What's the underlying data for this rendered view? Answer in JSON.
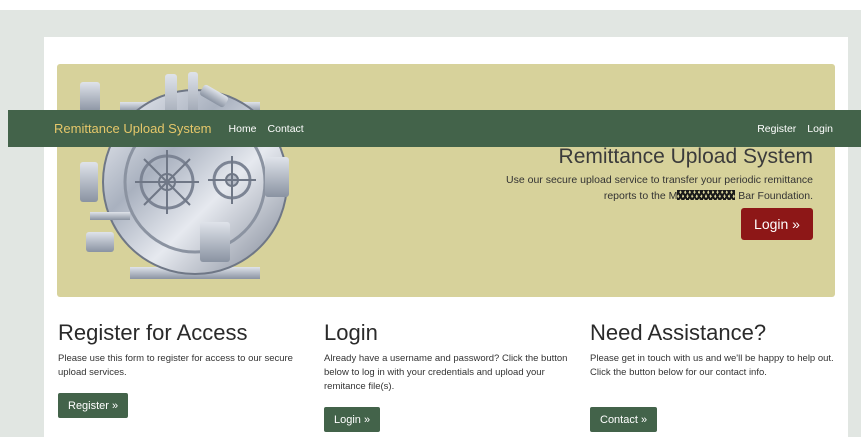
{
  "navbar": {
    "brand": "Remittance Upload System",
    "links": [
      "Home",
      "Contact"
    ],
    "right_links": [
      "Register",
      "Login"
    ]
  },
  "hero": {
    "title": "Remittance Upload System",
    "desc_line1": "Use our secure upload service to transfer your periodic remittance",
    "desc_line2_pre": "reports to the M",
    "desc_line2_post": " Bar Foundation.",
    "button": "Login »"
  },
  "columns": [
    {
      "title": "Register for Access",
      "text": "Please use this form to register for access to our secure upload services.",
      "button": "Register »"
    },
    {
      "title": "Login",
      "text": "Already have a username and password? Click the button below to log in with your credentials and upload your remitance file(s).",
      "button": "Login »"
    },
    {
      "title": "Need Assistance?",
      "text": "Please get in touch with us and we'll be happy to help out. Click the button below for our contact info.",
      "button": "Contact »"
    }
  ],
  "colors": {
    "navbar_bg": "#43634a",
    "brand": "#e5c76a",
    "hero_bg": "#d7d29b",
    "hero_button": "#8d1717",
    "button_green": "#43634a"
  },
  "icons": {
    "hero_image": "vault-door-icon"
  }
}
